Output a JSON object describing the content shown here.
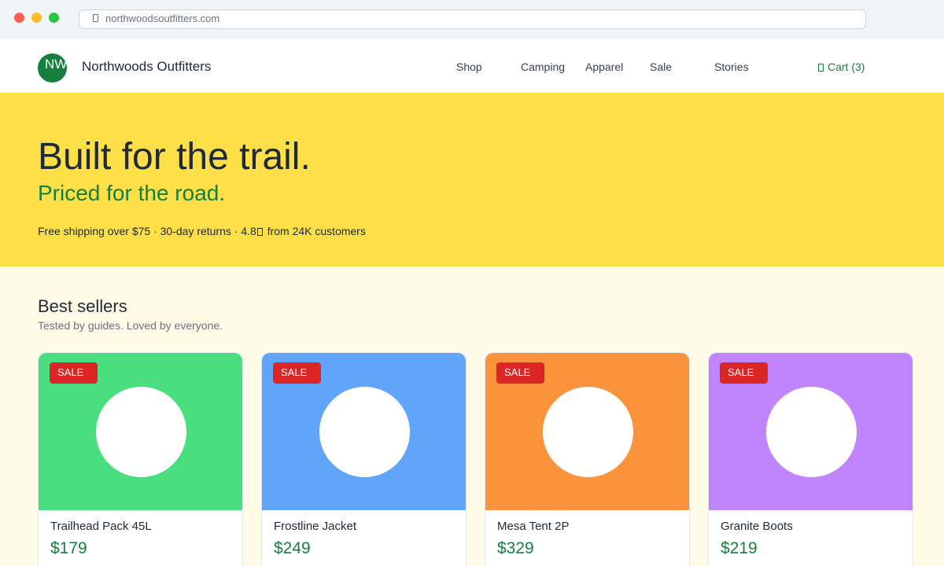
{
  "browser": {
    "url": "northwoodsoutfitters.com"
  },
  "header": {
    "logo_text": "NW",
    "brand": "Northwoods Outfitters",
    "nav": [
      "Shop",
      "Camping",
      "Apparel",
      "Sale",
      "Stories"
    ],
    "cart_label": "Cart (3)"
  },
  "hero": {
    "title": "Built for the trail.",
    "subtitle": "Priced for the road.",
    "stats_before_star": "Free shipping over $75 · 30-day returns · 4.8",
    "stats_after_star": "from 24K customers"
  },
  "section": {
    "title": "Best sellers",
    "subtitle": "Tested by guides. Loved by everyone."
  },
  "products": [
    {
      "badge": "SALE",
      "name": "Trailhead Pack 45L",
      "price": "$179",
      "color": "#4ade80"
    },
    {
      "badge": "SALE",
      "name": "Frostline Jacket",
      "price": "$249",
      "color": "#60a5fa"
    },
    {
      "badge": "SALE",
      "name": "Mesa Tent 2P",
      "price": "$329",
      "color": "#fb923c"
    },
    {
      "badge": "SALE",
      "name": "Granite Boots",
      "price": "$219",
      "color": "#c084fc"
    }
  ],
  "colors": {
    "accent": "#15803d",
    "hero_bg": "#fde047",
    "page_bg": "#fffbe6",
    "sale": "#dc2626"
  },
  "icons": {
    "address_bar": "lock-icon",
    "cart": "cart-icon",
    "rating": "star-icon"
  }
}
